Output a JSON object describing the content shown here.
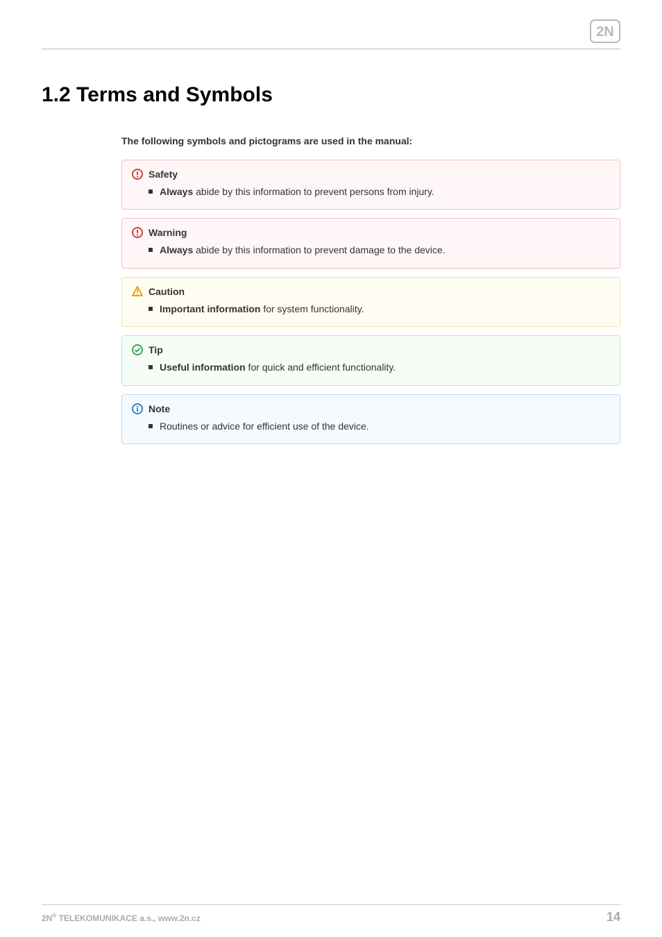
{
  "logo_text": "2N",
  "heading": "1.2 Terms and Symbols",
  "intro": "The following symbols and pictograms are used in the manual:",
  "callouts": {
    "safety": {
      "title": "Safety",
      "item_prefix": "Always",
      "item_rest": "  abide by this information to prevent persons from injury."
    },
    "warning": {
      "title": "Warning",
      "item_prefix": "Always",
      "item_rest": " abide by this information to prevent damage to the device."
    },
    "caution": {
      "title": "Caution",
      "item_prefix": "Important information",
      "item_rest": " for system functionality."
    },
    "tip": {
      "title": "Tip",
      "item_prefix": "Useful information",
      "item_rest": " for quick and efficient functionality."
    },
    "note": {
      "title": "Note",
      "item_prefix": "",
      "item_rest": "Routines or advice for efficient use of the device."
    }
  },
  "footer": {
    "company_prefix": "2N",
    "company_sup": "®",
    "company_rest": " TELEKOMUNIKACE a.s., www.2n.cz",
    "page_number": "14"
  },
  "colors": {
    "red_icon": "#d04437",
    "yellow_icon": "#e8a100",
    "green_icon": "#3aa757",
    "blue_icon": "#3b7fc4"
  }
}
